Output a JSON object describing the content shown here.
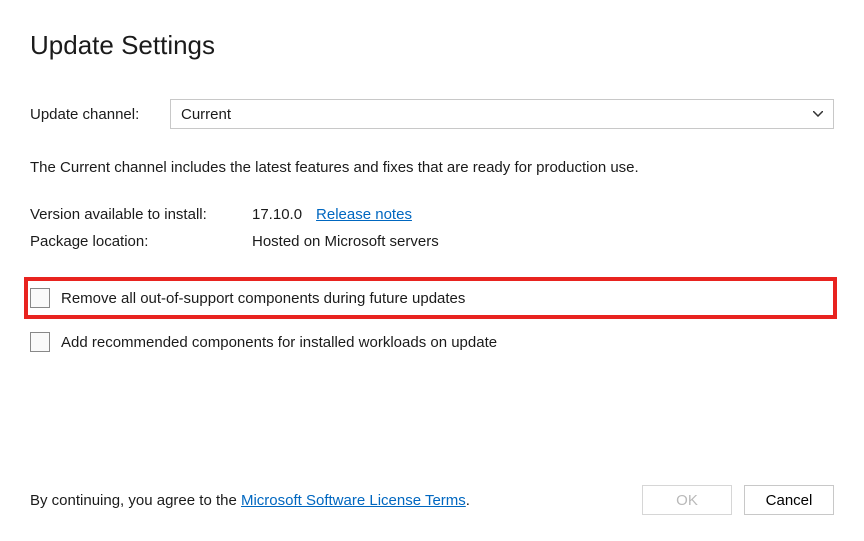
{
  "title": "Update Settings",
  "channel": {
    "label": "Update channel:",
    "value": "Current"
  },
  "description": "The Current channel includes the latest features and fixes that are ready for production use.",
  "info": {
    "versionLabel": "Version available to install:",
    "versionValue": "17.10.0",
    "releaseNotesLabel": "Release notes",
    "packageLabel": "Package location:",
    "packageValue": "Hosted on Microsoft servers"
  },
  "checkboxes": {
    "removeLabel": "Remove all out-of-support components during future updates",
    "addLabel": "Add recommended components for installed workloads on update"
  },
  "footer": {
    "prefix": "By continuing, you agree to the ",
    "linkText": "Microsoft Software License Terms",
    "suffix": ".",
    "okLabel": "OK",
    "cancelLabel": "Cancel"
  }
}
